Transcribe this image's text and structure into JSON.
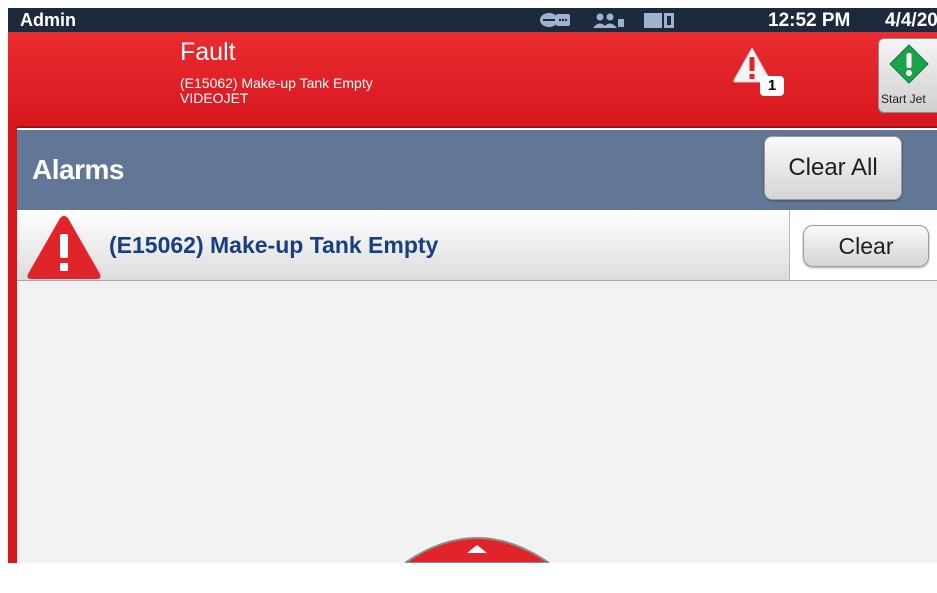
{
  "status_bar": {
    "user": "Admin",
    "time": "12:52 PM",
    "date": "4/4/20",
    "icons": [
      "connection-icon",
      "users-icon",
      "storage-icon"
    ]
  },
  "header": {
    "status": "Fault",
    "fault_code": "(E15062)  Make-up Tank Empty",
    "company": "VIDEOJET",
    "alarm_count": "1",
    "start_jet_label": "Start Jet"
  },
  "alarms_panel": {
    "title": "Alarms",
    "clear_all_label": "Clear All",
    "items": [
      {
        "message": "(E15062)  Make-up Tank Empty",
        "clear_label": "Clear",
        "severity": "fault"
      }
    ]
  },
  "colors": {
    "header_red": "#e0242a",
    "panel_blue": "#627795",
    "alarm_text": "#173f82",
    "status_bar": "#1d2a3e"
  }
}
